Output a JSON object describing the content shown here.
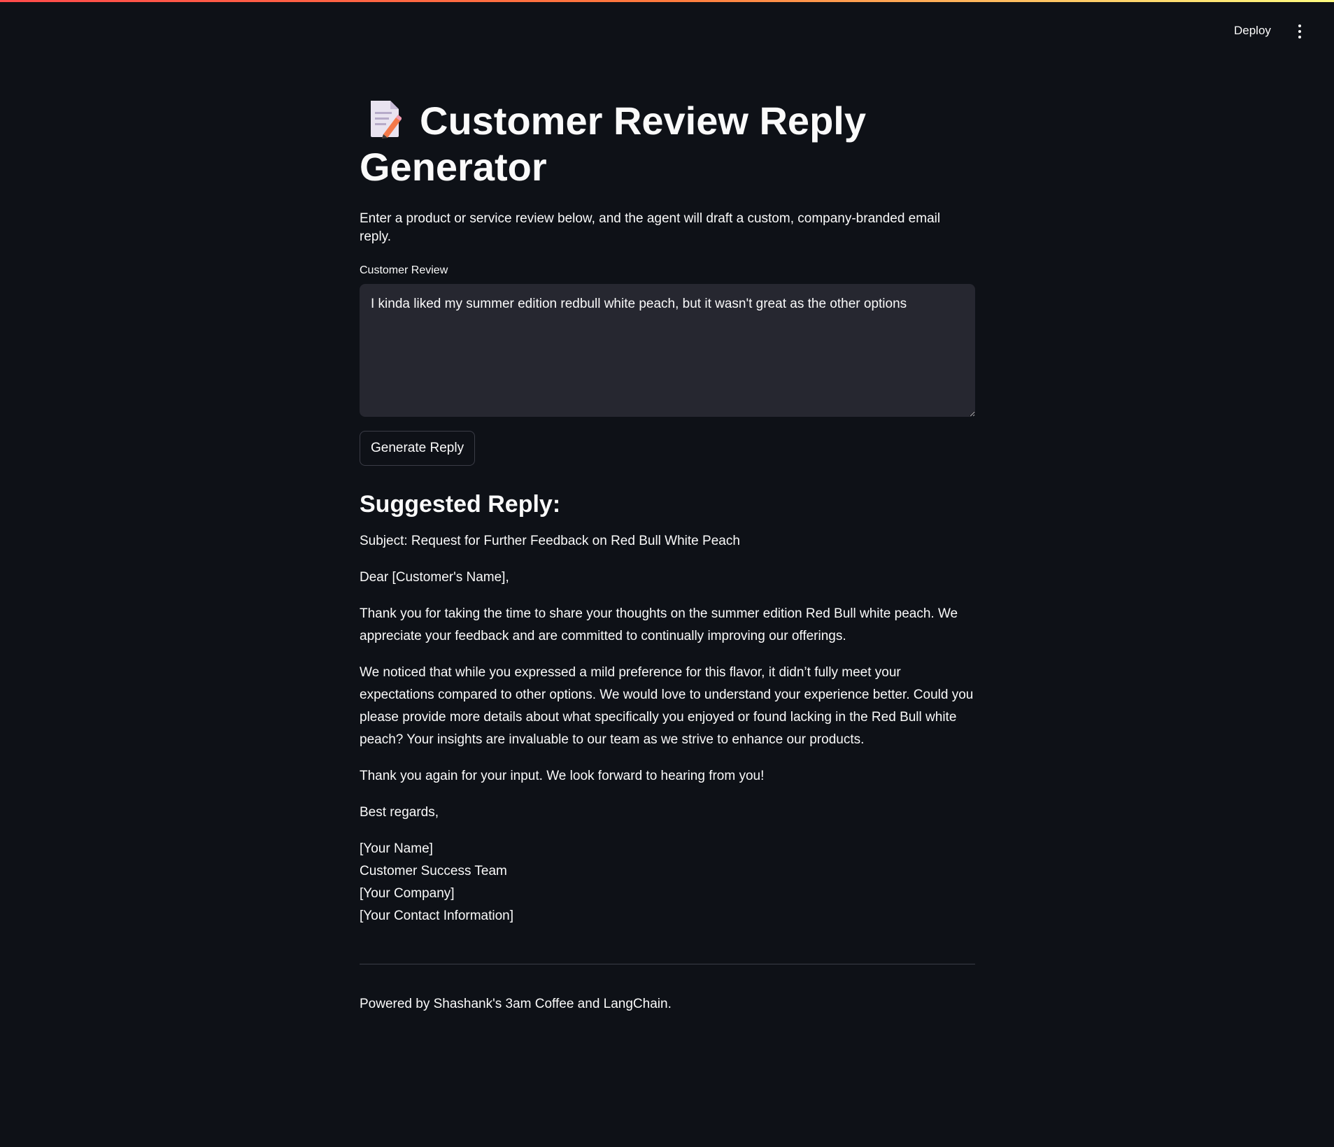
{
  "colors": {
    "background": "#0e1117",
    "text": "#fafafa",
    "input_bg": "#262730",
    "accent_gradient_start": "#ff4b4b",
    "accent_gradient_end": "#fffd80"
  },
  "header": {
    "deploy_label": "Deploy",
    "menu_icon": "vertical-ellipsis-icon"
  },
  "title": {
    "icon": "memo-icon",
    "text": "Customer Review Reply Generator"
  },
  "subtitle": "Enter a product or service review below, and the agent will draft a custom, company-branded email reply.",
  "review_field": {
    "label": "Customer Review",
    "value": "I kinda liked my summer edition redbull white peach, but it wasn't great as the other options"
  },
  "generate_button_label": "Generate Reply",
  "reply": {
    "heading": "Suggested Reply:",
    "subject": "Subject: Request for Further Feedback on Red Bull White Peach",
    "greeting": "Dear [Customer's Name],",
    "paragraph1": "Thank you for taking the time to share your thoughts on the summer edition Red Bull white peach. We appreciate your feedback and are committed to continually improving our offerings.",
    "paragraph2": "We noticed that while you expressed a mild preference for this flavor, it didn’t fully meet your expectations compared to other options. We would love to understand your experience better. Could you please provide more details about what specifically you enjoyed or found lacking in the Red Bull white peach? Your insights are invaluable to our team as we strive to enhance our products.",
    "paragraph3": "Thank you again for your input. We look forward to hearing from you!",
    "closing": "Best regards,",
    "signature": [
      "[Your Name]",
      "Customer Success Team",
      "[Your Company]",
      "[Your Contact Information]"
    ]
  },
  "footer": "Powered by Shashank's 3am Coffee and LangChain."
}
